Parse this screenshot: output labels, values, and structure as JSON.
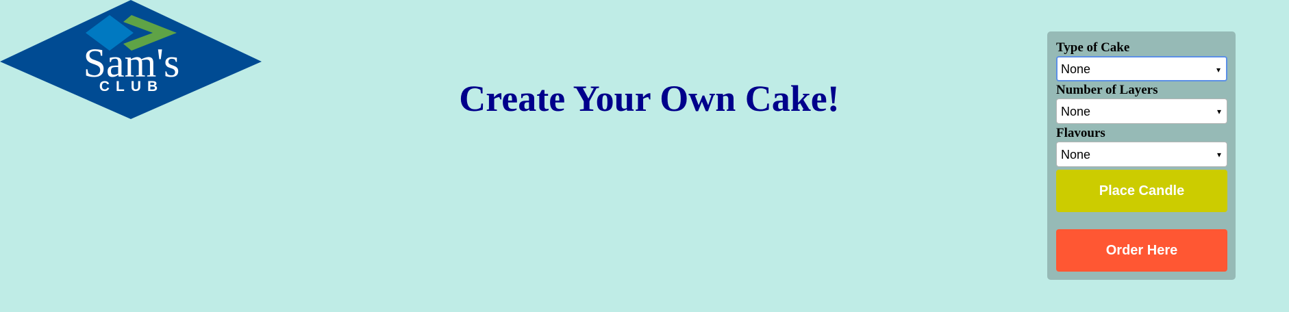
{
  "logo": {
    "brand_name": "Sam's",
    "brand_sub": "CLUB",
    "colors": {
      "diamond": "#004b93",
      "blue_chevron": "#0079c1",
      "green_chevron": "#5fa346"
    }
  },
  "page_title": "Create Your Own Cake!",
  "form": {
    "cake_type": {
      "label": "Type of Cake",
      "value": "None"
    },
    "layers": {
      "label": "Number of Layers",
      "value": "None"
    },
    "flavours": {
      "label": "Flavours",
      "value": "None"
    },
    "dropdown_icon": "▾",
    "place_candle_label": "Place Candle",
    "order_label": "Order Here"
  },
  "colors": {
    "background": "#bfece6",
    "panel": "#96bab6",
    "title": "#00008b",
    "place_candle": "#cccc00",
    "order": "#ff5733",
    "focus_ring": "#5b8fe6"
  }
}
